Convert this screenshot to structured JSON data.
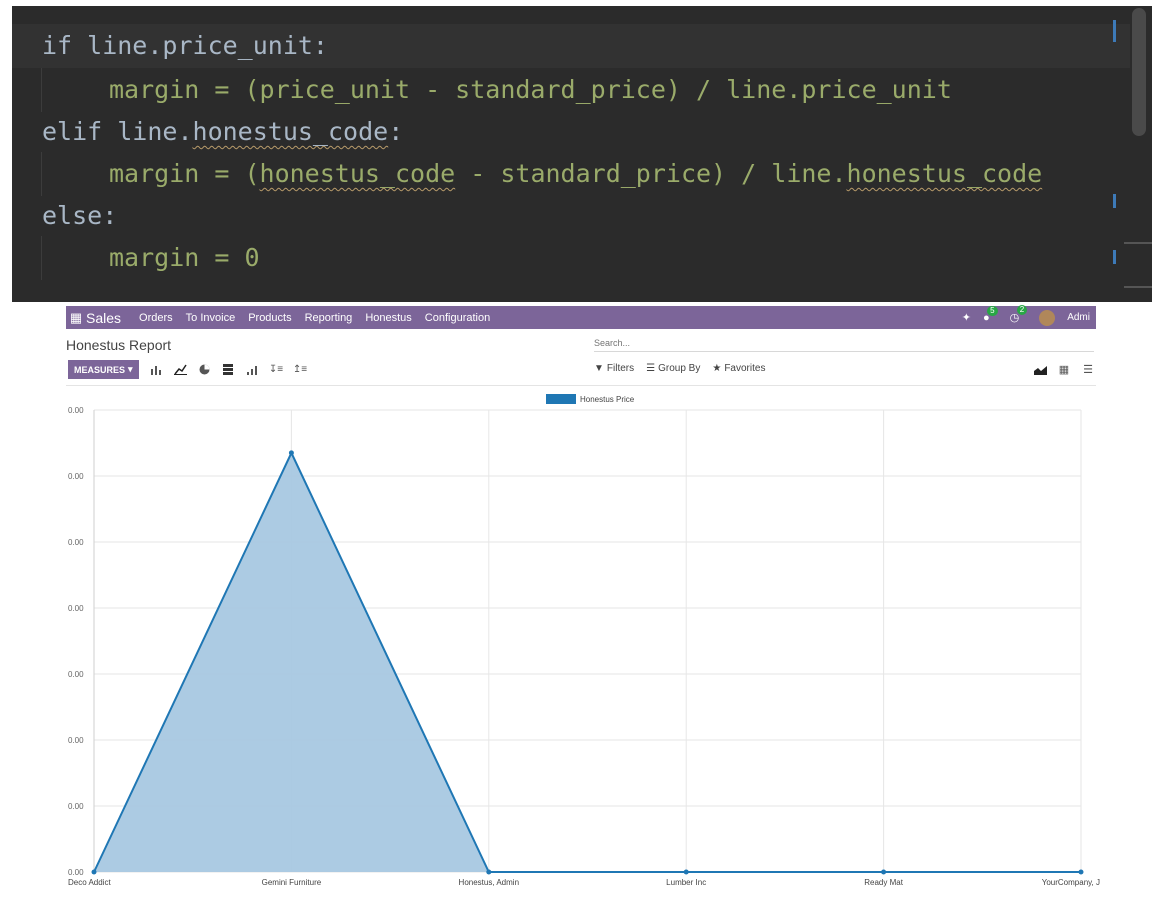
{
  "editor": {
    "lines": [
      {
        "parts": [
          {
            "t": "if line.price_unit:",
            "c": "tok-attr"
          }
        ]
      },
      {
        "parts": [
          {
            "t": "margin = (price_unit - standard_price) / line.price_unit",
            "c": "tok-var"
          }
        ]
      },
      {
        "parts": [
          {
            "t": "elif line.honestus_code:",
            "c": "tok-attr"
          }
        ]
      },
      {
        "parts": [
          {
            "t": "margin = (honestus_code - standard_price) / line.honestus_code",
            "c": "tok-var"
          }
        ]
      },
      {
        "parts": [
          {
            "t": "else:",
            "c": "tok-attr"
          }
        ]
      },
      {
        "parts": [
          {
            "t": "margin = 0",
            "c": "tok-var"
          }
        ]
      }
    ]
  },
  "nav": {
    "app": "Sales",
    "menu": [
      "Orders",
      "To Invoice",
      "Products",
      "Reporting",
      "Honestus",
      "Configuration"
    ],
    "chat_count": "5",
    "activity_count": "2",
    "user": "Admi"
  },
  "panel": {
    "title": "Honestus Report",
    "search_placeholder": "Search...",
    "measures": "MEASURES",
    "filters": "Filters",
    "group_by": "Group By",
    "favorites": "Favorites"
  },
  "chart_data": {
    "type": "area",
    "legend": "Honestus Price",
    "categories": [
      "Deco Addict",
      "Gemini Furniture",
      "Honestus, Admin",
      "Lumber Inc",
      "Ready Mat",
      "YourCompany, J"
    ],
    "values": [
      0,
      6.35,
      0,
      0,
      0,
      0
    ],
    "y_tick_labels": [
      "0.00",
      "0.00",
      "0.00",
      "0.00",
      "0.00",
      "0.00",
      "0.00",
      "0.00"
    ],
    "ylim": [
      0,
      7
    ],
    "grid": true,
    "colors": {
      "line": "#1f77b4",
      "fill": "#a8c8e2"
    }
  }
}
